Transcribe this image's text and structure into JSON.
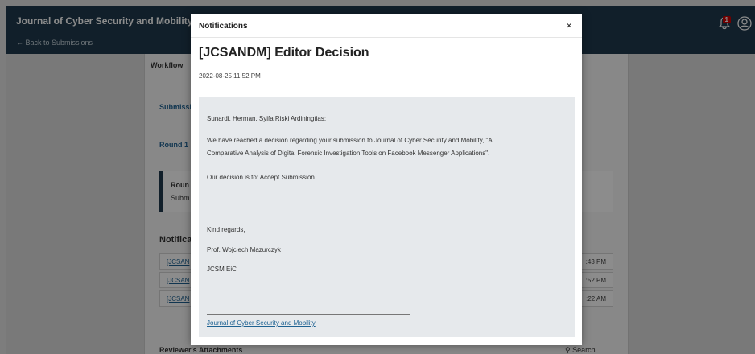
{
  "app": {
    "title": "Journal of Cyber Security and Mobility",
    "back_link": "← Back to Submissions",
    "notification_count": "1"
  },
  "background": {
    "workflow_label": "Workflow",
    "submission_tab": "Submissi",
    "round_tab": "Round 1",
    "round_panel_title": "Roun",
    "round_panel_sub": "Subm",
    "notifications_heading": "Notifica",
    "rows": [
      {
        "left": "[JCSAN",
        "right": ":43 PM"
      },
      {
        "left": "[JCSAN",
        "right": ":52 PM"
      },
      {
        "left": "[JCSAN",
        "right": ":22 AM"
      }
    ],
    "attachments_heading": "Reviewer's Attachments",
    "search_label": "Search"
  },
  "modal": {
    "header": "Notifications",
    "close_label": "×",
    "subject": "[JCSANDM] Editor Decision",
    "date": "2022-08-25 11:52 PM",
    "body": {
      "greeting": "Sunardi, Herman, Syifa Riski Ardiningtias:",
      "paragraph_line1": "We have reached a decision regarding your submission to Journal of Cyber Security and Mobility, \"A",
      "paragraph_line2": "Comparative Analysis of Digital Forensic Investigation Tools on Facebook Messenger Applications\".",
      "decision": "Our decision is to: Accept Submission",
      "closing": "Kind regards,",
      "signer": "Prof. Wojciech Mazurczyk",
      "signer_title": "JCSM EiC",
      "footer_link": "Journal of Cyber Security and Mobility"
    }
  }
}
